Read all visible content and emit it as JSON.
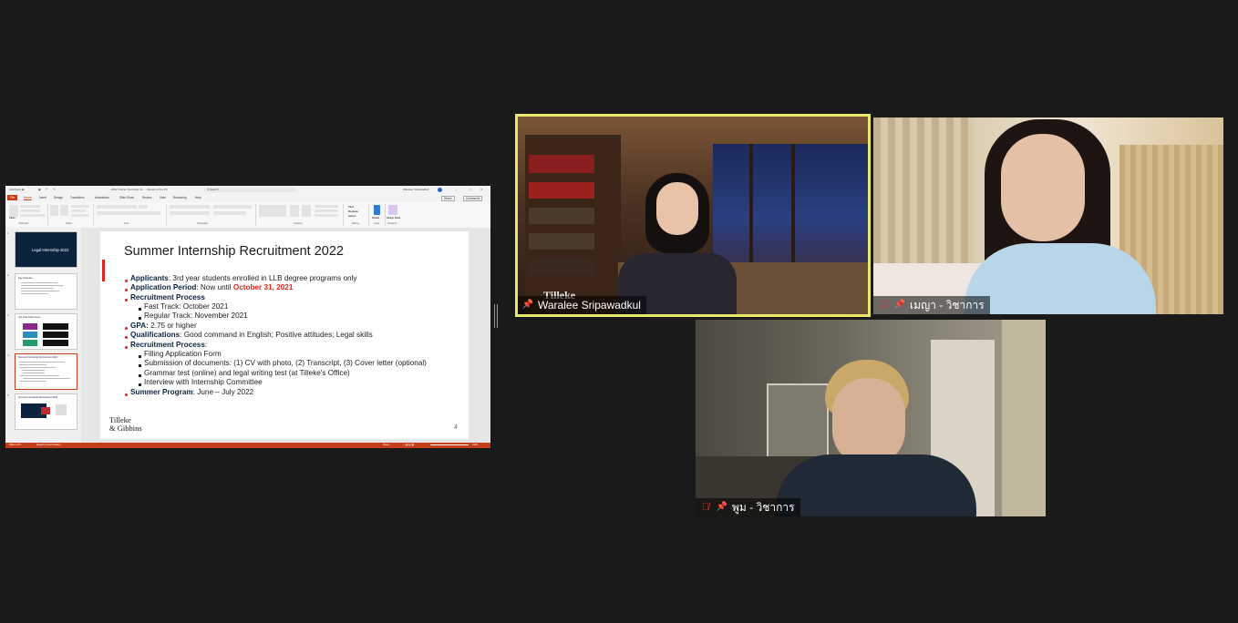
{
  "shared_screen": {
    "window_title": "2022 Online Internship for... - Saved to this PC",
    "search_placeholder": "Search",
    "user_name": "Waralee Sripawadkul",
    "ribbon_tabs": [
      "File",
      "Home",
      "Insert",
      "Design",
      "Transitions",
      "Animations",
      "Slide Show",
      "Review",
      "View",
      "Recording",
      "Help"
    ],
    "share_label": "Share",
    "comments_label": "Comments",
    "ribbon_groups": [
      "Clipboard",
      "Slides",
      "Font",
      "Paragraph",
      "Drawing",
      "Editing",
      "Voice",
      "Designer"
    ],
    "ribbon_buttons": {
      "paste": "Paste",
      "new_slide": "New Slide",
      "reuse_slides": "Reuse Slides",
      "layout": "Layout",
      "reset": "Reset",
      "section": "Section",
      "arrange": "Arrange",
      "quick_styles": "Quick Styles",
      "find": "Find",
      "replace": "Replace",
      "select": "Select",
      "dictate": "Dictate",
      "design_ideas": "Design Ideas"
    },
    "thumbnails": [
      {
        "number": "1",
        "title": "Legal Internship 2022"
      },
      {
        "number": "2",
        "title": "Key Features"
      },
      {
        "number": "3",
        "title": "Our Internship Focus"
      },
      {
        "number": "4",
        "title": "Summer Internship Recruitment 2022"
      },
      {
        "number": "5",
        "title": "Summer Internship Recruitment 2022"
      }
    ],
    "slide": {
      "title": "Summer Internship Recruitment 2022",
      "applicants_label": "Applicants",
      "applicants_text": ": 3rd year students enrolled in LLB degree programs only",
      "application_period_label": "Application Period",
      "application_period_text": ": Now until ",
      "application_period_date": "October 31, 2021",
      "recruitment_process_label": "Recruitment Process",
      "fast_track": "Fast Track: October 2021",
      "regular_track": "Regular Track: November 2021",
      "gpa_label": "GPA:",
      "gpa_text": " 2.75 or higher",
      "qualifications_label": "Qualifications",
      "qualifications_text": ": Good command in English; Positive attitudes; Legal skills",
      "recruitment_process_label_2": "Recruitment Process",
      "recruitment_process_colon": ":",
      "steps": [
        "Filling Application Form",
        "Submission of documents: (1) CV with photo, (2) Transcript, (3) Cover letter (optional)",
        "Grammar test (online) and legal writing test (at Tilleke's Office)",
        "Interview with Internship Committee"
      ],
      "summer_program_label": "Summer Program",
      "summer_program_text": ": June – July 2022",
      "logo_line1": "Tilleke",
      "logo_line2": "& Gibbins",
      "page_number": "4"
    },
    "status_bar": {
      "slide_info": "Slide 4 of 5",
      "accessibility": "English (United States)",
      "notes": "Notes",
      "zoom": "119%"
    },
    "accent_color": "#c43e1c"
  },
  "participants": [
    {
      "name": "Waralee Sripawadkul",
      "background_logo": "Tilleke",
      "active_speaker": true,
      "muted": false,
      "pinned": true
    },
    {
      "name": "เมญา - วิชาการ",
      "active_speaker": false,
      "muted": true,
      "pinned": true
    },
    {
      "name": "พูม - วิชาการ",
      "active_speaker": false,
      "muted": true,
      "pinned": true
    }
  ],
  "colors": {
    "active_speaker_border": "#e8e86a",
    "muted_icon": "#e03030",
    "meeting_background": "#1a1a1a"
  }
}
